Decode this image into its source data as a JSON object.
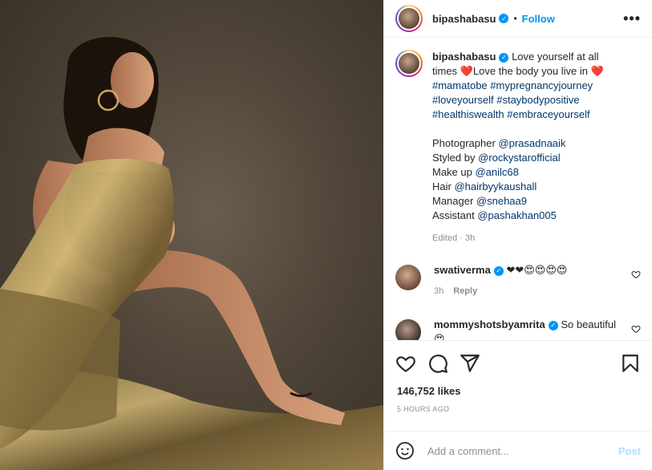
{
  "header": {
    "username": "bipashabasu",
    "separator": "•",
    "follow_label": "Follow",
    "more_label": "•••"
  },
  "caption": {
    "username": "bipashabasu",
    "text_lead": " Love yourself at all times ❤️Love the body you live in ❤️",
    "hashtags": [
      "#mamatobe",
      "#mypregnancyjourney",
      "#loveyourself",
      "#staybodypositive",
      "#healthiswealth",
      "#embraceyourself"
    ],
    "credits": [
      {
        "label": "Photographer ",
        "handle": "@prasadnaaik"
      },
      {
        "label": "Styled by ",
        "handle": "@rockystarofficial"
      },
      {
        "label": "Make up ",
        "handle": "@anilc68"
      },
      {
        "label": "Hair ",
        "handle": "@hairbyykaushall"
      },
      {
        "label": "Manager ",
        "handle": "@snehaa9"
      },
      {
        "label": "Assistant ",
        "handle": "@pashakhan005"
      }
    ],
    "edited": "Edited · 3h"
  },
  "comments": [
    {
      "username": "swativerma",
      "text": " ❤❤😍😍😍😍",
      "time": "3h",
      "reply": "Reply"
    },
    {
      "username": "mommyshotsbyamrita",
      "text": " So beautiful 😍",
      "time": "",
      "reply": ""
    }
  ],
  "likes": "146,752 likes",
  "timestamp": "5 HOURS AGO",
  "add_comment": {
    "placeholder": "Add a comment...",
    "post_label": "Post"
  },
  "colors": {
    "link": "#00376b",
    "accent": "#0095f6",
    "post_disabled": "#b2dffc",
    "verified": "#0095f6"
  },
  "icons": [
    "more-icon",
    "verified-icon",
    "heart-icon",
    "comment-icon",
    "share-icon",
    "bookmark-icon",
    "emoji-icon"
  ]
}
